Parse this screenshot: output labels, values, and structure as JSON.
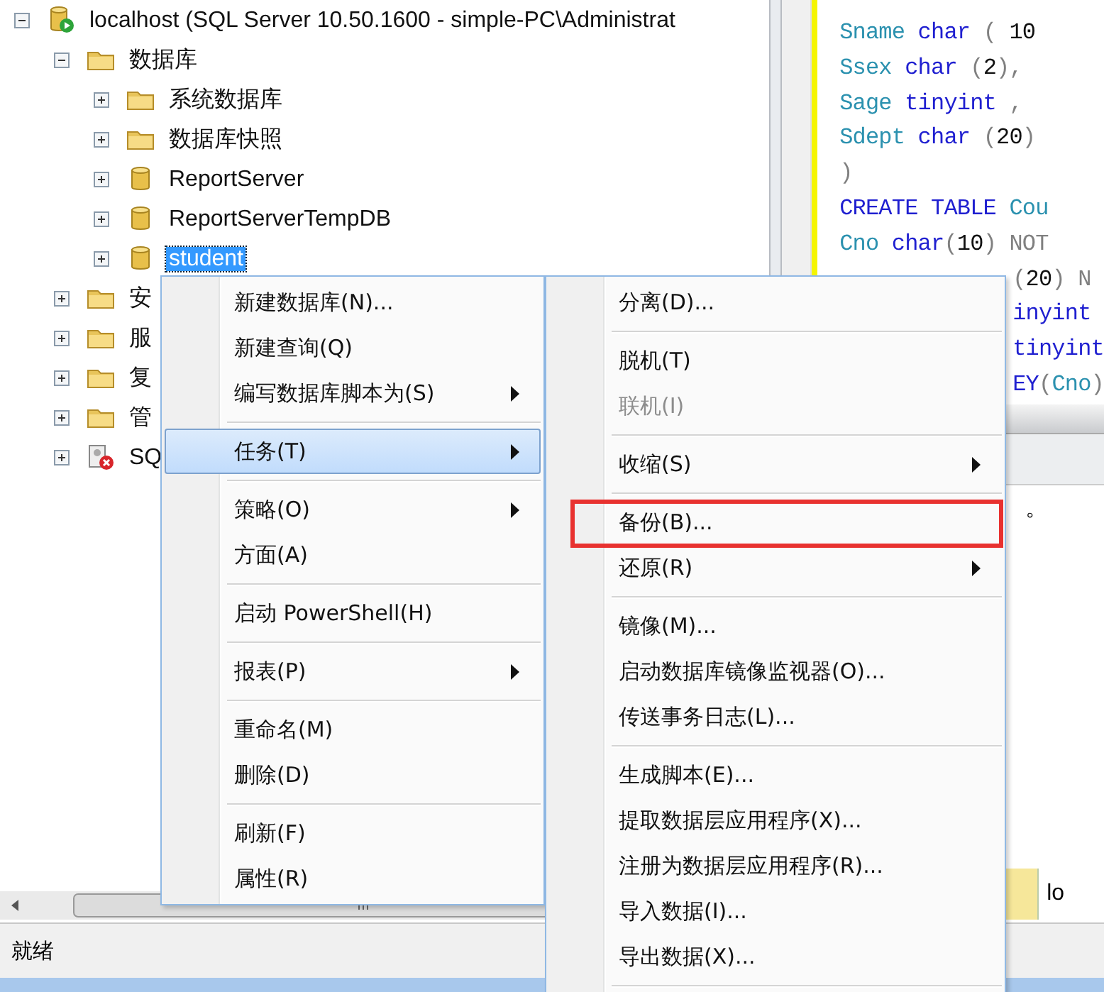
{
  "object_explorer": {
    "tree": {
      "label": "localhost (SQL Server 10.50.1600 - simple-PC\\Administrat",
      "kind": "server",
      "expanded": true,
      "selected": false,
      "children": [
        {
          "label": "数据库",
          "kind": "folder",
          "expanded": true,
          "selected": false,
          "children": [
            {
              "label": "系统数据库",
              "kind": "folder",
              "expanded": false,
              "selected": false
            },
            {
              "label": "数据库快照",
              "kind": "folder",
              "expanded": false,
              "selected": false
            },
            {
              "label": "ReportServer",
              "kind": "database",
              "expanded": false,
              "selected": false
            },
            {
              "label": "ReportServerTempDB",
              "kind": "database",
              "expanded": false,
              "selected": false
            },
            {
              "label": "student",
              "kind": "database",
              "expanded": false,
              "selected": true
            }
          ]
        },
        {
          "label": "安",
          "kind": "folder",
          "expanded": false,
          "selected": false
        },
        {
          "label": "服",
          "kind": "folder",
          "expanded": false,
          "selected": false
        },
        {
          "label": "复",
          "kind": "folder",
          "expanded": false,
          "selected": false
        },
        {
          "label": "管",
          "kind": "folder",
          "expanded": false,
          "selected": false
        },
        {
          "label": "SQ",
          "kind": "agent",
          "expanded": false,
          "selected": false
        }
      ]
    }
  },
  "editor": {
    "lines": [
      {
        "kind": "full",
        "tokens": [
          {
            "t": "Sname ",
            "kind": "ident"
          },
          {
            "t": "char ",
            "kind": "keyword"
          },
          {
            "t": "( ",
            "kind": "punct"
          },
          {
            "t": "10",
            "kind": "plain"
          }
        ]
      },
      {
        "kind": "full",
        "tokens": [
          {
            "t": "Ssex ",
            "kind": "ident"
          },
          {
            "t": "char ",
            "kind": "keyword"
          },
          {
            "t": "(",
            "kind": "punct"
          },
          {
            "t": "2",
            "kind": "plain"
          },
          {
            "t": "),",
            "kind": "punct"
          }
        ]
      },
      {
        "kind": "full",
        "tokens": [
          {
            "t": "Sage ",
            "kind": "ident"
          },
          {
            "t": "tinyint ",
            "kind": "keyword"
          },
          {
            "t": ",",
            "kind": "punct"
          }
        ]
      },
      {
        "kind": "full",
        "tokens": [
          {
            "t": "Sdept ",
            "kind": "ident"
          },
          {
            "t": "char ",
            "kind": "keyword"
          },
          {
            "t": "(",
            "kind": "punct"
          },
          {
            "t": "20",
            "kind": "plain"
          },
          {
            "t": ")",
            "kind": "punct"
          }
        ]
      },
      {
        "kind": "full",
        "tokens": [
          {
            "t": ")",
            "kind": "punct"
          }
        ]
      },
      {
        "kind": "full",
        "tokens": [
          {
            "t": "CREATE TABLE ",
            "kind": "keyword"
          },
          {
            "t": "Cou",
            "kind": "ident"
          }
        ]
      },
      {
        "kind": "full",
        "tokens": [
          {
            "t": "Cno ",
            "kind": "ident"
          },
          {
            "t": "char",
            "kind": "keyword"
          },
          {
            "t": "(",
            "kind": "punct"
          },
          {
            "t": "10",
            "kind": "plain"
          },
          {
            "t": ") NOT",
            "kind": "punct"
          }
        ]
      },
      {
        "kind": "partial",
        "tokens": [
          {
            "t": "(",
            "kind": "punct"
          },
          {
            "t": "20",
            "kind": "plain"
          },
          {
            "t": ") N",
            "kind": "punct"
          }
        ]
      },
      {
        "kind": "partial",
        "tokens": [
          {
            "t": "inyint",
            "kind": "keyword"
          }
        ]
      },
      {
        "kind": "partial",
        "tokens": [
          {
            "t": "tinyint",
            "kind": "keyword"
          }
        ]
      },
      {
        "kind": "partial",
        "tokens": [
          {
            "t": "EY",
            "kind": "keyword"
          },
          {
            "t": "(",
            "kind": "punct"
          },
          {
            "t": "Cno",
            "kind": "ident"
          },
          {
            "t": ")",
            "kind": "punct"
          }
        ]
      }
    ]
  },
  "messages": {
    "text": "。"
  },
  "results_footer": {
    "cell": "lo"
  },
  "status_bar": {
    "text": "就绪"
  },
  "context_menu": {
    "items": [
      {
        "kind": "item",
        "label": "新建数据库(N)...",
        "submenu": false,
        "selected": false,
        "disabled": false
      },
      {
        "kind": "item",
        "label": "新建查询(Q)",
        "submenu": false,
        "selected": false,
        "disabled": false
      },
      {
        "kind": "item",
        "label": "编写数据库脚本为(S)",
        "submenu": true,
        "selected": false,
        "disabled": false
      },
      {
        "kind": "separator"
      },
      {
        "kind": "item",
        "label": "任务(T)",
        "submenu": true,
        "selected": true,
        "disabled": false
      },
      {
        "kind": "separator"
      },
      {
        "kind": "item",
        "label": "策略(O)",
        "submenu": true,
        "selected": false,
        "disabled": false
      },
      {
        "kind": "item",
        "label": "方面(A)",
        "submenu": false,
        "selected": false,
        "disabled": false
      },
      {
        "kind": "separator"
      },
      {
        "kind": "item",
        "label": "启动 PowerShell(H)",
        "submenu": false,
        "selected": false,
        "disabled": false
      },
      {
        "kind": "separator"
      },
      {
        "kind": "item",
        "label": "报表(P)",
        "submenu": true,
        "selected": false,
        "disabled": false
      },
      {
        "kind": "separator"
      },
      {
        "kind": "item",
        "label": "重命名(M)",
        "submenu": false,
        "selected": false,
        "disabled": false
      },
      {
        "kind": "item",
        "label": "删除(D)",
        "submenu": false,
        "selected": false,
        "disabled": false
      },
      {
        "kind": "separator"
      },
      {
        "kind": "item",
        "label": "刷新(F)",
        "submenu": false,
        "selected": false,
        "disabled": false
      },
      {
        "kind": "item",
        "label": "属性(R)",
        "submenu": false,
        "selected": false,
        "disabled": false
      }
    ]
  },
  "tasks_submenu": {
    "items": [
      {
        "kind": "item",
        "label": "分离(D)...",
        "submenu": false,
        "selected": false,
        "disabled": false,
        "annotated": false
      },
      {
        "kind": "separator"
      },
      {
        "kind": "item",
        "label": "脱机(T)",
        "submenu": false,
        "selected": false,
        "disabled": false,
        "annotated": false
      },
      {
        "kind": "item",
        "label": "联机(I)",
        "submenu": false,
        "selected": false,
        "disabled": true,
        "annotated": false
      },
      {
        "kind": "separator"
      },
      {
        "kind": "item",
        "label": "收缩(S)",
        "submenu": true,
        "selected": false,
        "disabled": false,
        "annotated": false
      },
      {
        "kind": "separator"
      },
      {
        "kind": "item",
        "label": "备份(B)...",
        "submenu": false,
        "selected": false,
        "disabled": false,
        "annotated": true
      },
      {
        "kind": "item",
        "label": "还原(R)",
        "submenu": true,
        "selected": false,
        "disabled": false,
        "annotated": false
      },
      {
        "kind": "separator"
      },
      {
        "kind": "item",
        "label": "镜像(M)...",
        "submenu": false,
        "selected": false,
        "disabled": false,
        "annotated": false
      },
      {
        "kind": "item",
        "label": "启动数据库镜像监视器(O)...",
        "submenu": false,
        "selected": false,
        "disabled": false,
        "annotated": false
      },
      {
        "kind": "item",
        "label": "传送事务日志(L)...",
        "submenu": false,
        "selected": false,
        "disabled": false,
        "annotated": false
      },
      {
        "kind": "separator"
      },
      {
        "kind": "item",
        "label": "生成脚本(E)...",
        "submenu": false,
        "selected": false,
        "disabled": false,
        "annotated": false
      },
      {
        "kind": "item",
        "label": "提取数据层应用程序(X)...",
        "submenu": false,
        "selected": false,
        "disabled": false,
        "annotated": false
      },
      {
        "kind": "item",
        "label": "注册为数据层应用程序(R)...",
        "submenu": false,
        "selected": false,
        "disabled": false,
        "annotated": false
      },
      {
        "kind": "item",
        "label": "导入数据(I)...",
        "submenu": false,
        "selected": false,
        "disabled": false,
        "annotated": false
      },
      {
        "kind": "item",
        "label": "导出数据(X)...",
        "submenu": false,
        "selected": false,
        "disabled": false,
        "annotated": false
      },
      {
        "kind": "separator"
      }
    ]
  }
}
